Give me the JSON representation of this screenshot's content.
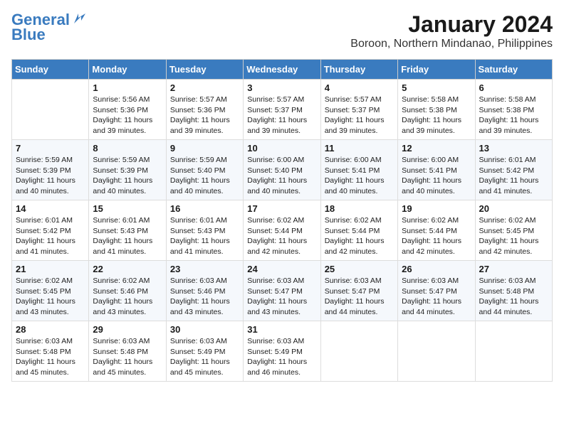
{
  "header": {
    "logo_line1": "General",
    "logo_line2": "Blue",
    "month_year": "January 2024",
    "location": "Boroon, Northern Mindanao, Philippines"
  },
  "days_of_week": [
    "Sunday",
    "Monday",
    "Tuesday",
    "Wednesday",
    "Thursday",
    "Friday",
    "Saturday"
  ],
  "weeks": [
    [
      {
        "day": "",
        "info": ""
      },
      {
        "day": "1",
        "info": "Sunrise: 5:56 AM\nSunset: 5:36 PM\nDaylight: 11 hours\nand 39 minutes."
      },
      {
        "day": "2",
        "info": "Sunrise: 5:57 AM\nSunset: 5:36 PM\nDaylight: 11 hours\nand 39 minutes."
      },
      {
        "day": "3",
        "info": "Sunrise: 5:57 AM\nSunset: 5:37 PM\nDaylight: 11 hours\nand 39 minutes."
      },
      {
        "day": "4",
        "info": "Sunrise: 5:57 AM\nSunset: 5:37 PM\nDaylight: 11 hours\nand 39 minutes."
      },
      {
        "day": "5",
        "info": "Sunrise: 5:58 AM\nSunset: 5:38 PM\nDaylight: 11 hours\nand 39 minutes."
      },
      {
        "day": "6",
        "info": "Sunrise: 5:58 AM\nSunset: 5:38 PM\nDaylight: 11 hours\nand 39 minutes."
      }
    ],
    [
      {
        "day": "7",
        "info": "Sunrise: 5:59 AM\nSunset: 5:39 PM\nDaylight: 11 hours\nand 40 minutes."
      },
      {
        "day": "8",
        "info": "Sunrise: 5:59 AM\nSunset: 5:39 PM\nDaylight: 11 hours\nand 40 minutes."
      },
      {
        "day": "9",
        "info": "Sunrise: 5:59 AM\nSunset: 5:40 PM\nDaylight: 11 hours\nand 40 minutes."
      },
      {
        "day": "10",
        "info": "Sunrise: 6:00 AM\nSunset: 5:40 PM\nDaylight: 11 hours\nand 40 minutes."
      },
      {
        "day": "11",
        "info": "Sunrise: 6:00 AM\nSunset: 5:41 PM\nDaylight: 11 hours\nand 40 minutes."
      },
      {
        "day": "12",
        "info": "Sunrise: 6:00 AM\nSunset: 5:41 PM\nDaylight: 11 hours\nand 40 minutes."
      },
      {
        "day": "13",
        "info": "Sunrise: 6:01 AM\nSunset: 5:42 PM\nDaylight: 11 hours\nand 41 minutes."
      }
    ],
    [
      {
        "day": "14",
        "info": "Sunrise: 6:01 AM\nSunset: 5:42 PM\nDaylight: 11 hours\nand 41 minutes."
      },
      {
        "day": "15",
        "info": "Sunrise: 6:01 AM\nSunset: 5:43 PM\nDaylight: 11 hours\nand 41 minutes."
      },
      {
        "day": "16",
        "info": "Sunrise: 6:01 AM\nSunset: 5:43 PM\nDaylight: 11 hours\nand 41 minutes."
      },
      {
        "day": "17",
        "info": "Sunrise: 6:02 AM\nSunset: 5:44 PM\nDaylight: 11 hours\nand 42 minutes."
      },
      {
        "day": "18",
        "info": "Sunrise: 6:02 AM\nSunset: 5:44 PM\nDaylight: 11 hours\nand 42 minutes."
      },
      {
        "day": "19",
        "info": "Sunrise: 6:02 AM\nSunset: 5:44 PM\nDaylight: 11 hours\nand 42 minutes."
      },
      {
        "day": "20",
        "info": "Sunrise: 6:02 AM\nSunset: 5:45 PM\nDaylight: 11 hours\nand 42 minutes."
      }
    ],
    [
      {
        "day": "21",
        "info": "Sunrise: 6:02 AM\nSunset: 5:45 PM\nDaylight: 11 hours\nand 43 minutes."
      },
      {
        "day": "22",
        "info": "Sunrise: 6:02 AM\nSunset: 5:46 PM\nDaylight: 11 hours\nand 43 minutes."
      },
      {
        "day": "23",
        "info": "Sunrise: 6:03 AM\nSunset: 5:46 PM\nDaylight: 11 hours\nand 43 minutes."
      },
      {
        "day": "24",
        "info": "Sunrise: 6:03 AM\nSunset: 5:47 PM\nDaylight: 11 hours\nand 43 minutes."
      },
      {
        "day": "25",
        "info": "Sunrise: 6:03 AM\nSunset: 5:47 PM\nDaylight: 11 hours\nand 44 minutes."
      },
      {
        "day": "26",
        "info": "Sunrise: 6:03 AM\nSunset: 5:47 PM\nDaylight: 11 hours\nand 44 minutes."
      },
      {
        "day": "27",
        "info": "Sunrise: 6:03 AM\nSunset: 5:48 PM\nDaylight: 11 hours\nand 44 minutes."
      }
    ],
    [
      {
        "day": "28",
        "info": "Sunrise: 6:03 AM\nSunset: 5:48 PM\nDaylight: 11 hours\nand 45 minutes."
      },
      {
        "day": "29",
        "info": "Sunrise: 6:03 AM\nSunset: 5:48 PM\nDaylight: 11 hours\nand 45 minutes."
      },
      {
        "day": "30",
        "info": "Sunrise: 6:03 AM\nSunset: 5:49 PM\nDaylight: 11 hours\nand 45 minutes."
      },
      {
        "day": "31",
        "info": "Sunrise: 6:03 AM\nSunset: 5:49 PM\nDaylight: 11 hours\nand 46 minutes."
      },
      {
        "day": "",
        "info": ""
      },
      {
        "day": "",
        "info": ""
      },
      {
        "day": "",
        "info": ""
      }
    ]
  ]
}
